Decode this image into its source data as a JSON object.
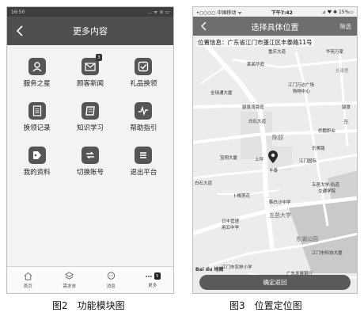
{
  "left_phone": {
    "status": {
      "time": "16:50",
      "icons": "... ᯤ ≋ ▭"
    },
    "title": "更多内容",
    "grid": [
      {
        "label": "服务之星",
        "icon": "star-person-icon"
      },
      {
        "label": "顾客新闻",
        "icon": "envelope-icon",
        "badge": "3"
      },
      {
        "label": "礼品换领",
        "icon": "checkbox-icon"
      },
      {
        "label": "换领记录",
        "icon": "document-icon"
      },
      {
        "label": "知识学习",
        "icon": "notebook-icon"
      },
      {
        "label": "帮助指引",
        "icon": "wave-icon"
      },
      {
        "label": "我的资料",
        "icon": "tag-icon"
      },
      {
        "label": "切换账号",
        "icon": "switch-icon"
      },
      {
        "label": "退出平台",
        "icon": "list-exit-icon"
      }
    ],
    "tabs": [
      {
        "label": "首页",
        "icon": "home-icon"
      },
      {
        "label": "需求单",
        "icon": "layers-icon"
      },
      {
        "label": "消息",
        "icon": "chat-icon"
      },
      {
        "label": "更多",
        "icon": "more-icon",
        "badge": "5"
      }
    ]
  },
  "right_phone": {
    "status": {
      "carrier": "•○○○○ 中国移动 ᯤ",
      "time": "下午7:42",
      "battery": "⊿ ♥ ✱ 15%▭"
    },
    "title": "选择具体位置",
    "action": "筛选",
    "location_info": "位置信息：广东省江门市蓬江区丰泰路11号",
    "map_labels": {
      "l1": "重庆大道",
      "l2": "华苑万家",
      "l3": "莱面华庭",
      "l4": "长康里",
      "l5": "江门万达广场",
      "l6": "购物中心",
      "l7": "全球通大厦",
      "l8": "骏景湾豪庭",
      "l9": "骏景",
      "l10": "白石大道",
      "l11": "侨鹏职业",
      "l12": "陈颐",
      "l13": "东",
      "l14": "乐美路",
      "l15": "宝翔大厦",
      "l16": "上坪",
      "l17": "江门国际",
      "l18": "五邑大学-轨道",
      "l19": "交通学院",
      "l20": "卜棒莲花",
      "l21": "韩白沙中学",
      "l22": "五邑大学",
      "l23": "日丰管理",
      "l24": "用五中学",
      "l25": "东湖公园",
      "l26": "江门市科协大厦",
      "l27": "江门市农林小学",
      "l28": "广东发展银行",
      "l29": "丰泰",
      "l30": "白石大道"
    },
    "logo": "Bai du 地图",
    "confirm": "确定返回"
  },
  "captions": {
    "left": "图2　功能模块图",
    "right": "图3　位置定位图"
  }
}
